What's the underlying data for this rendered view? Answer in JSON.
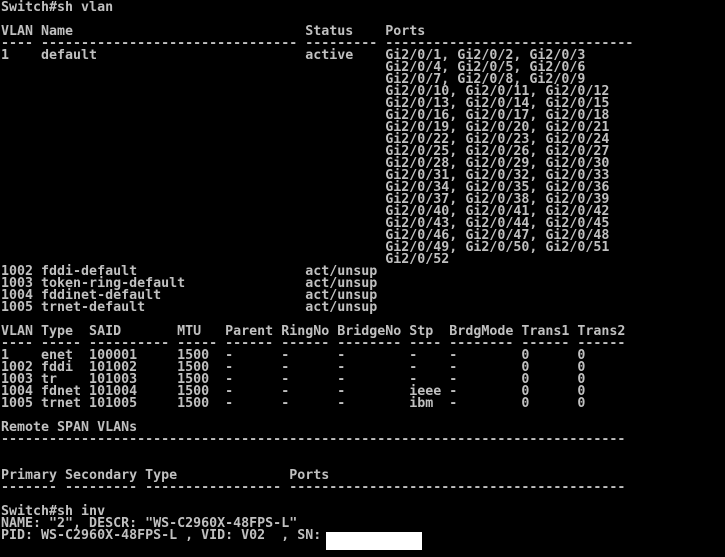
{
  "colors": {
    "background": "#000000",
    "text": "#c0c0c0",
    "redaction": "#ffffff"
  },
  "terminal": {
    "lines": [
      "Switch#sh vlan",
      "",
      "VLAN Name                             Status    Ports",
      "---- -------------------------------- --------- -------------------------------",
      "1    default                          active    Gi2/0/1, Gi2/0/2, Gi2/0/3",
      "                                                Gi2/0/4, Gi2/0/5, Gi2/0/6",
      "                                                Gi2/0/7, Gi2/0/8, Gi2/0/9",
      "                                                Gi2/0/10, Gi2/0/11, Gi2/0/12",
      "                                                Gi2/0/13, Gi2/0/14, Gi2/0/15",
      "                                                Gi2/0/16, Gi2/0/17, Gi2/0/18",
      "                                                Gi2/0/19, Gi2/0/20, Gi2/0/21",
      "                                                Gi2/0/22, Gi2/0/23, Gi2/0/24",
      "                                                Gi2/0/25, Gi2/0/26, Gi2/0/27",
      "                                                Gi2/0/28, Gi2/0/29, Gi2/0/30",
      "                                                Gi2/0/31, Gi2/0/32, Gi2/0/33",
      "                                                Gi2/0/34, Gi2/0/35, Gi2/0/36",
      "                                                Gi2/0/37, Gi2/0/38, Gi2/0/39",
      "                                                Gi2/0/40, Gi2/0/41, Gi2/0/42",
      "                                                Gi2/0/43, Gi2/0/44, Gi2/0/45",
      "                                                Gi2/0/46, Gi2/0/47, Gi2/0/48",
      "                                                Gi2/0/49, Gi2/0/50, Gi2/0/51",
      "                                                Gi2/0/52",
      "1002 fddi-default                     act/unsup",
      "1003 token-ring-default               act/unsup",
      "1004 fddinet-default                  act/unsup",
      "1005 trnet-default                    act/unsup",
      "",
      "VLAN Type  SAID       MTU   Parent RingNo BridgeNo Stp  BrdgMode Trans1 Trans2",
      "---- ----- ---------- ----- ------ ------ -------- ---- -------- ------ ------",
      "1    enet  100001     1500  -      -      -        -    -        0      0",
      "1002 fddi  101002     1500  -      -      -        -    -        0      0",
      "1003 tr    101003     1500  -      -      -        -    -        0      0",
      "1004 fdnet 101004     1500  -      -      -        ieee -        0      0",
      "1005 trnet 101005     1500  -      -      -        ibm  -        0      0",
      "",
      "Remote SPAN VLANs",
      "------------------------------------------------------------------------------",
      "",
      "",
      "Primary Secondary Type              Ports",
      "------- --------- ----------------- ------------------------------------------",
      "",
      "Switch#sh inv",
      "NAME: \"2\", DESCR: \"WS-C2960X-48FPS-L\"",
      "PID: WS-C2960X-48FPS-L , VID: V02  , SN:"
    ]
  }
}
